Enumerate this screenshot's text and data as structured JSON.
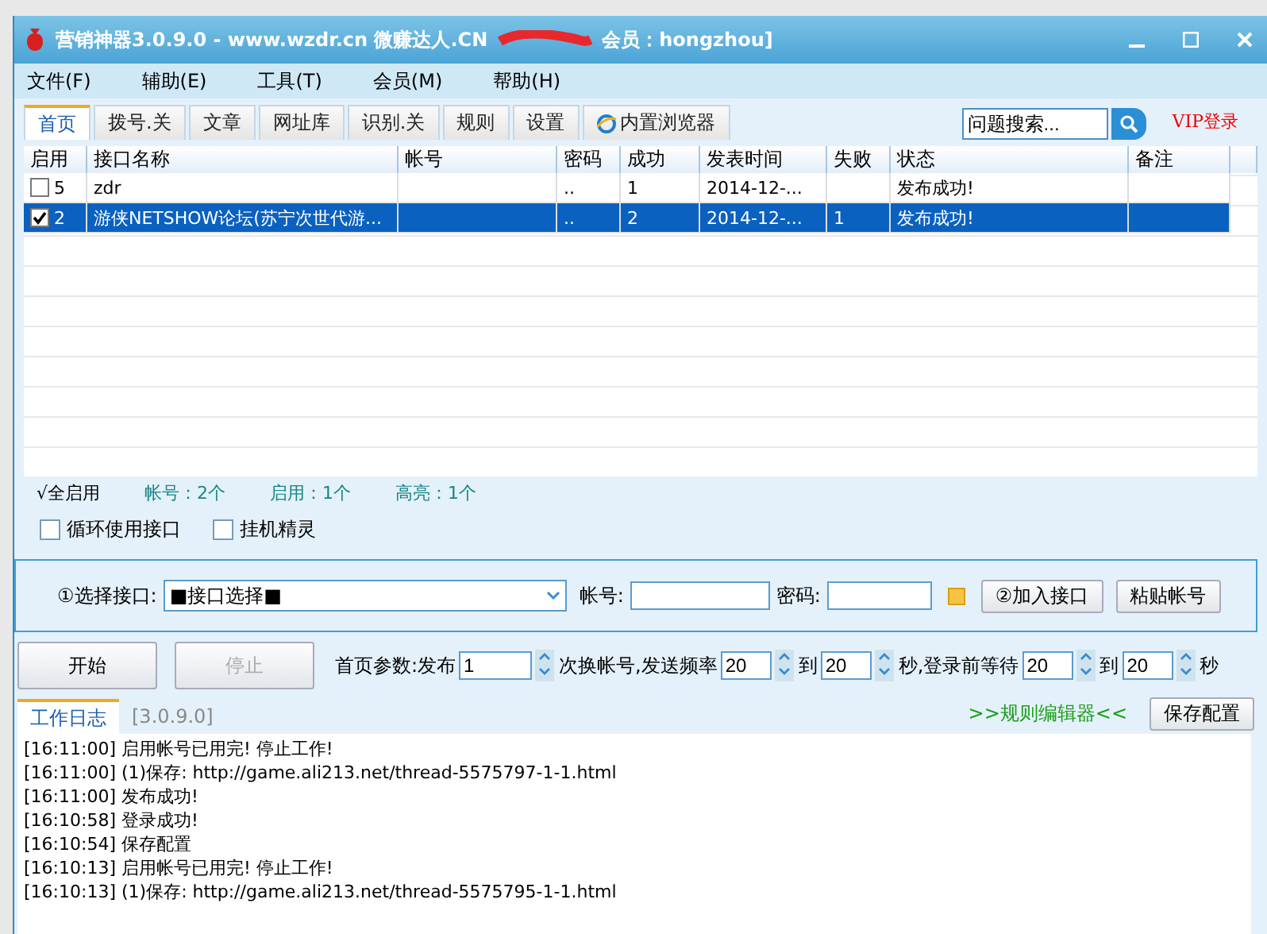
{
  "window": {
    "title": "营销神器3.0.9.0 - www.wzdr.cn 微赚达人.CN",
    "title_tail": "会员：hongzhou]"
  },
  "menu": [
    "文件(F)",
    "辅助(E)",
    "工具(T)",
    "会员(M)",
    "帮助(H)"
  ],
  "tabs": [
    {
      "label": "首页",
      "selected": true
    },
    {
      "label": "拨号.关",
      "selected": false
    },
    {
      "label": "文章",
      "selected": false
    },
    {
      "label": "网址库",
      "selected": false
    },
    {
      "label": "识别.关",
      "selected": false
    },
    {
      "label": "规则",
      "selected": false
    },
    {
      "label": "设置",
      "selected": false
    },
    {
      "label": "内置浏览器",
      "selected": false
    }
  ],
  "search": {
    "value": "问题搜索..."
  },
  "vip_link": "VIP登录",
  "table": {
    "columns": [
      "启用",
      "接口名称",
      "帐号",
      "密码",
      "成功",
      "发表时间",
      "失败",
      "状态",
      "备注"
    ],
    "rows": [
      {
        "checked": false,
        "selected": false,
        "cells": [
          "5",
          "zdr",
          "",
          "..",
          "1",
          "2014-12-...",
          "",
          "发布成功!",
          ""
        ]
      },
      {
        "checked": true,
        "selected": true,
        "cells": [
          "2",
          "游侠NETSHOW论坛(苏宁次世代游...",
          "",
          "..",
          "2",
          "2014-12-...",
          "1",
          "发布成功!",
          ""
        ]
      }
    ]
  },
  "summary": {
    "enable_all": "√全启用",
    "counts": [
      "帐号：2个",
      "启用：1个",
      "高亮：1个"
    ]
  },
  "options": [
    {
      "label": "循环使用接口",
      "checked": false
    },
    {
      "label": "挂机精灵",
      "checked": false
    }
  ],
  "interface": {
    "select_label": "①选择接口:",
    "select_value": "■接口选择■",
    "account_label": "帐号:",
    "password_label": "密码:",
    "add_button": "②加入接口",
    "paste_button": "粘贴帐号"
  },
  "controls": {
    "start": "开始",
    "stop": {
      "label": "停止",
      "disabled": true
    },
    "params": [
      {
        "before": "首页参数:发布",
        "value": "1"
      },
      {
        "before": "次换帐号,发送频率",
        "value": "20"
      },
      {
        "before": "到",
        "value": "20"
      },
      {
        "before": "秒,登录前等待",
        "value": "20"
      },
      {
        "before": "到",
        "value": "20"
      }
    ],
    "after": "秒"
  },
  "log": {
    "tabs": [
      {
        "label": "工作日志",
        "selected": true
      },
      {
        "label": "[3.0.9.0]",
        "selected": false
      }
    ],
    "rule_editor": ">>规则编辑器<<",
    "save_button": "保存配置",
    "lines": [
      "[16:11:00] 启用帐号已用完! 停止工作!",
      "[16:11:00] (1)保存: http://game.ali213.net/thread-5575797-1-1.html",
      "[16:11:00] 发布成功!",
      "[16:10:58] 登录成功!",
      "[16:10:54] 保存配置",
      "[16:10:13] 启用帐号已用完! 停止工作!",
      "[16:10:13] (1)保存: http://game.ali213.net/thread-5575795-1-1.html"
    ]
  }
}
